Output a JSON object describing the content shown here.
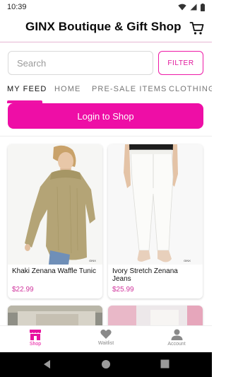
{
  "status_bar": {
    "time": "10:39"
  },
  "header": {
    "title": "GINX Boutique & Gift Shop",
    "cart_icon": "cart-icon"
  },
  "search": {
    "placeholder": "Search",
    "value": ""
  },
  "filter": {
    "label": "FILTER"
  },
  "tabs": [
    {
      "label": "MY FEED",
      "active": true
    },
    {
      "label": "HOME",
      "active": false
    },
    {
      "label": "PRE-SALE ITEMS",
      "active": false
    },
    {
      "label": "CLOTHING",
      "active": false
    }
  ],
  "login": {
    "label": "Login to Shop"
  },
  "products": [
    {
      "name": "Khaki Zenana Waffle Tunic",
      "price": "$22.99"
    },
    {
      "name": "Ivory Stretch Zenana Jeans",
      "price": "$25.99"
    }
  ],
  "bottom_nav": [
    {
      "label": "Shop",
      "icon": "shop-icon",
      "active": true
    },
    {
      "label": "Waitlist",
      "icon": "heart-icon",
      "active": false
    },
    {
      "label": "Account",
      "icon": "account-icon",
      "active": false
    }
  ],
  "colors": {
    "accent": "#EE0EA6",
    "price": "#D0359D"
  }
}
